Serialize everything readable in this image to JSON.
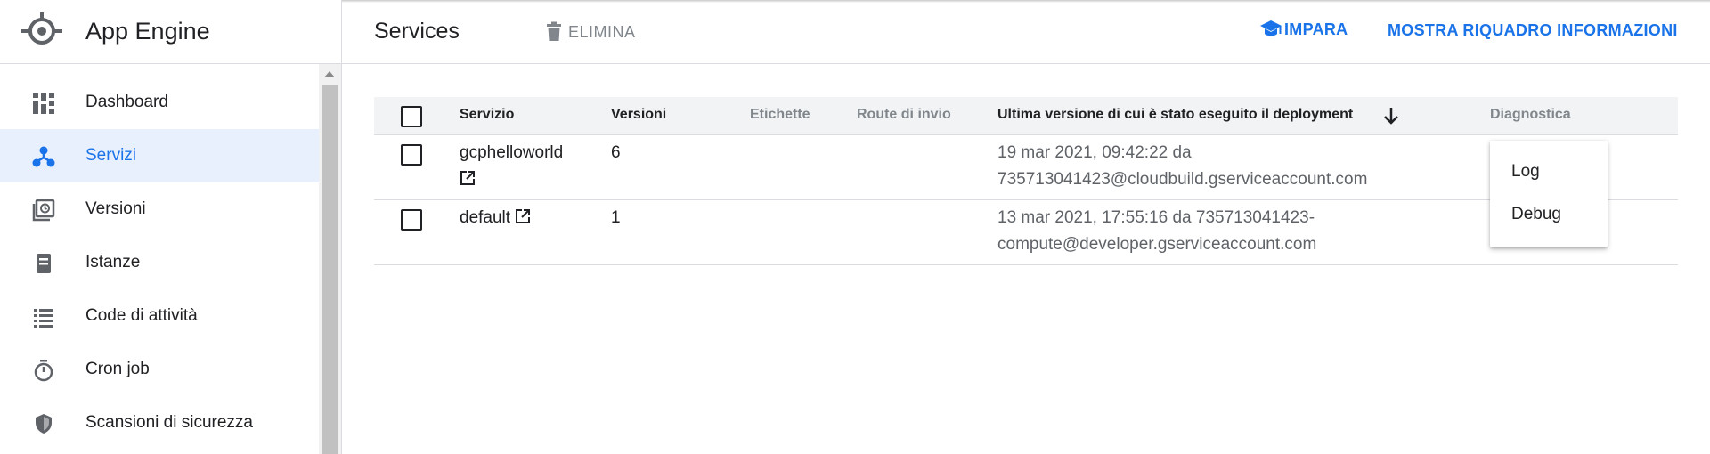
{
  "app": {
    "title": "App Engine",
    "logo_icon": "app-engine-logo-icon"
  },
  "sidebar": {
    "items": [
      {
        "label": "Dashboard",
        "icon": "dashboard-icon",
        "active": false
      },
      {
        "label": "Servizi",
        "icon": "services-icon",
        "active": true
      },
      {
        "label": "Versioni",
        "icon": "versions-icon",
        "active": false
      },
      {
        "label": "Istanze",
        "icon": "instances-icon",
        "active": false
      },
      {
        "label": "Code di attività",
        "icon": "task-queues-icon",
        "active": false
      },
      {
        "label": "Cron job",
        "icon": "timer-icon",
        "active": false
      },
      {
        "label": "Scansioni di sicurezza",
        "icon": "shield-icon",
        "active": false
      }
    ]
  },
  "header": {
    "title": "Services",
    "delete_label": "ELIMINA",
    "learn_label": "IMPARA",
    "info_panel_label": "MOSTRA RIQUADRO INFORMAZIONI"
  },
  "table": {
    "columns": [
      "Servizio",
      "Versioni",
      "Etichette",
      "Route di invio",
      "Ultima versione di cui è stato eseguito il deployment",
      "Diagnostica"
    ],
    "sort_indicator": "arrow-down-icon",
    "rows": [
      {
        "service": "gcphelloworld",
        "versions": "6",
        "last_deploy_line1": "19 mar 2021, 09:42:22 da",
        "last_deploy_line2": "735713041423@cloudbuild.gserviceaccount.com"
      },
      {
        "service": "default",
        "versions": "1",
        "last_deploy_line1": "13 mar 2021, 17:55:16 da 735713041423-",
        "last_deploy_line2": "compute@developer.gserviceaccount.com"
      }
    ]
  },
  "diagnostics_menu": {
    "items": [
      "Log",
      "Debug"
    ]
  },
  "colors": {
    "accent": "#1a73e8",
    "active_bg": "#e8f0fe",
    "header_bg": "#f1f3f4",
    "muted": "#80868b"
  }
}
